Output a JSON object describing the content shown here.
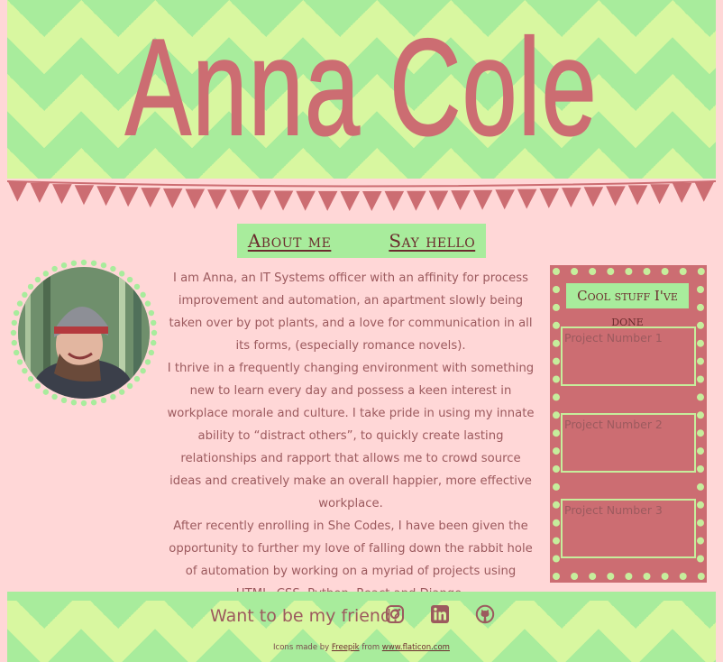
{
  "header": {
    "name": "Anna Cole"
  },
  "nav": {
    "about": "About me",
    "hello": "Say hello"
  },
  "about": {
    "p1": "I am Anna, an IT Systems officer with an affinity for process improvement and automation, an apartment slowly being taken over by pot plants, and a love for communication in all its forms, (especially romance novels).",
    "p2": "I thrive in a frequently changing environment with something new to learn every day and possess a keen interest in workplace morale and culture. I take pride in using my innate ability to “distract others”, to quickly create lasting relationships and rapport that allows me to crowd source ideas and creatively make an overall happier, more effective workplace.",
    "p3": "After recently enrolling in She Codes, I have been given the opportunity to further my love of falling down the rabbit hole of automation by working on a myriad of projects using HTML, CSS, Python, React and Django."
  },
  "sidebar": {
    "title": "Cool stuff I've done",
    "projects": [
      "Project Number 1",
      "Project Number 2",
      "Project Number 3"
    ]
  },
  "footer": {
    "friend": "Want to be my friend?",
    "icons": [
      "instagram-icon",
      "linkedin-icon",
      "github-icon"
    ],
    "credit_prefix": "Icons made by",
    "credit_author": "Freepik",
    "credit_mid": "from",
    "credit_site": "www.flaticon.com"
  },
  "colors": {
    "background": "#ffd7d7",
    "accent": "#cc6d72",
    "green": "#a8ec9c",
    "lime": "#d8f7a0",
    "text": "#9c5a5e"
  }
}
